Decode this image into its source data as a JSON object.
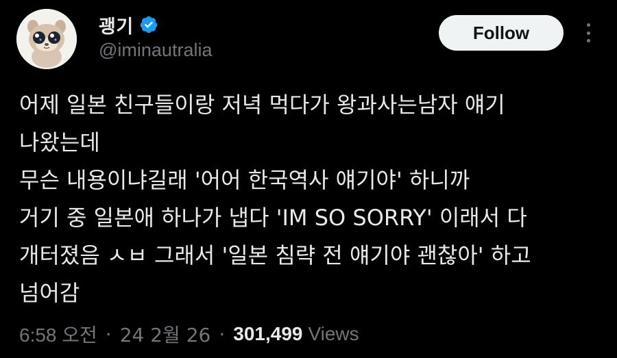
{
  "user": {
    "display_name": "괭기",
    "handle": "@iminautralia",
    "avatar_icon": "plush-toy-avatar-icon",
    "verified_icon": "verified-badge-icon",
    "verified_color": "#1d9bf0"
  },
  "actions": {
    "follow_label": "Follow",
    "more_icon": "more-vertical-icon"
  },
  "tweet": {
    "lines": [
      "어제 일본 친구들이랑 저녁 먹다가 왕과사는남자 얘기",
      "나왔는데",
      "무슨 내용이냐길래 '어어 한국역사 얘기야' 하니까",
      "거기 중 일본애 하나가 냅다 'IM SO SORRY' 이래서 다",
      "개터졌음 ㅅㅂ 그래서 '일본 침략 전 얘기야 괜찮아' 하고",
      "넘어감"
    ]
  },
  "meta": {
    "time": "6:58 오전",
    "separator": "·",
    "date": "24 2월 26",
    "views_count": "301,499",
    "views_label": "Views"
  },
  "colors": {
    "background": "#000000",
    "primary_text": "#e7e9ea",
    "secondary_text": "#71767b",
    "follow_bg": "#eff3f4",
    "follow_text": "#0f1419"
  }
}
